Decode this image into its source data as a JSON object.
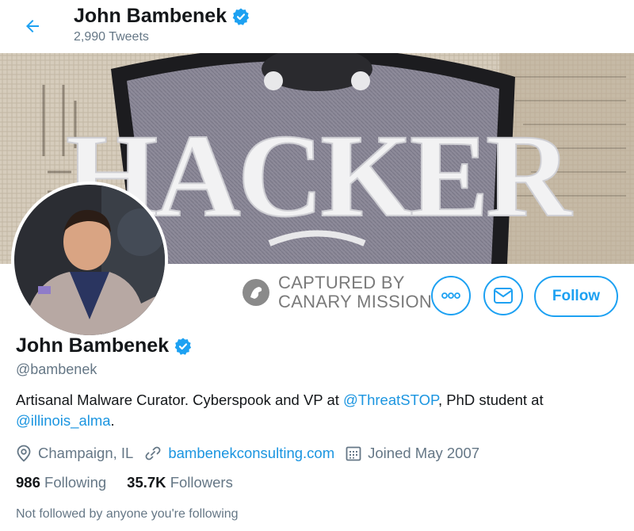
{
  "header": {
    "name": "John Bambenek",
    "tweet_count": "2,990 Tweets",
    "back_icon": "arrow-left-icon"
  },
  "banner": {
    "text": "HACKER"
  },
  "watermark": {
    "line1": "CAPTURED BY",
    "line2": "CANARY MISSION"
  },
  "actions": {
    "more_icon": "more-dots-icon",
    "message_icon": "envelope-icon",
    "follow_label": "Follow"
  },
  "profile": {
    "name": "John Bambenek",
    "handle": "@bambenek",
    "bio_part1": "Artisanal Malware Curator. Cyberspook and VP at ",
    "bio_mention1": "@ThreatSTOP",
    "bio_part2": ", PhD student at",
    "bio_mention2": "@illinois_alma",
    "bio_part3": ".",
    "location": "Champaign, IL",
    "website": "bambenekconsulting.com",
    "joined": "Joined May 2007",
    "following_count": "986",
    "following_label": "Following",
    "followers_count": "35.7K",
    "followers_label": "Followers",
    "followed_note": "Not followed by anyone you're following"
  },
  "colors": {
    "accent": "#1da1f2",
    "link": "#1b95e0",
    "muted": "#657786",
    "text": "#14171a"
  }
}
